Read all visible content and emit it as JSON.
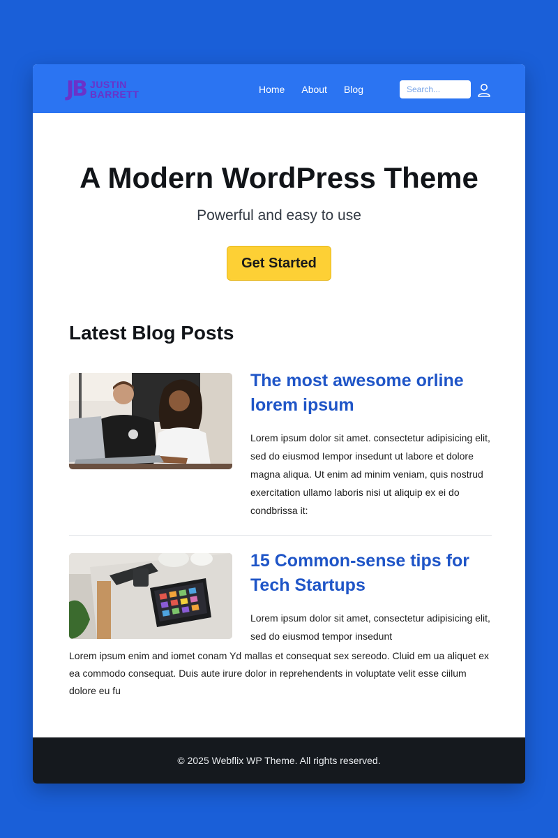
{
  "header": {
    "logo_mark": "JB",
    "logo_line1": "JUSTIN",
    "logo_line2": "BARRETT",
    "nav": [
      {
        "label": "Home"
      },
      {
        "label": "About"
      },
      {
        "label": "Blog"
      }
    ],
    "search_placeholder": "Search...",
    "user_icon": "user-icon"
  },
  "hero": {
    "title": "A Modern WordPress Theme",
    "subtitle": "Powerful and easy to use",
    "cta_label": "Get Started"
  },
  "latest": {
    "section_title": "Latest Blog Posts",
    "posts": [
      {
        "title": "The most awesome orline lorem ipsum",
        "excerpt": "Lorem ipsum dolor sit amet. consectetur adipisicing elit, sed do eiusmod Iempor insedunt ut labore et dolore magna aliqua. Ut enim ad minim veniam, quis nostrud exercitation ullamo laboris nisi ut aliquip ex ei do condbrissa it:"
      },
      {
        "title": "15 Common-sense tips for Tech Startups",
        "excerpt_a": "Lorem ipsum dolor sit amet, consectetur adipisicing elit, sed do eiusmod tempor insedunt",
        "excerpt_b": "Lorem ipsum enim and iomet conam Yd mallas et consequat sex sereodo. Cluid em ua aliquet ex ea commodo consequat. Duis aute irure dolor in reprehendents in voluptate velit esse ciilum dolore eu fu"
      }
    ]
  },
  "footer": {
    "text": "© 2025 Webflix WP Theme. All rights reserved."
  },
  "colors": {
    "page_bg": "#1a5fd8",
    "header_bg": "#2b74f2",
    "logo": "#6a32c9",
    "accent_button": "#fdd035",
    "post_title": "#1f55c7",
    "footer_bg": "#15191e"
  }
}
